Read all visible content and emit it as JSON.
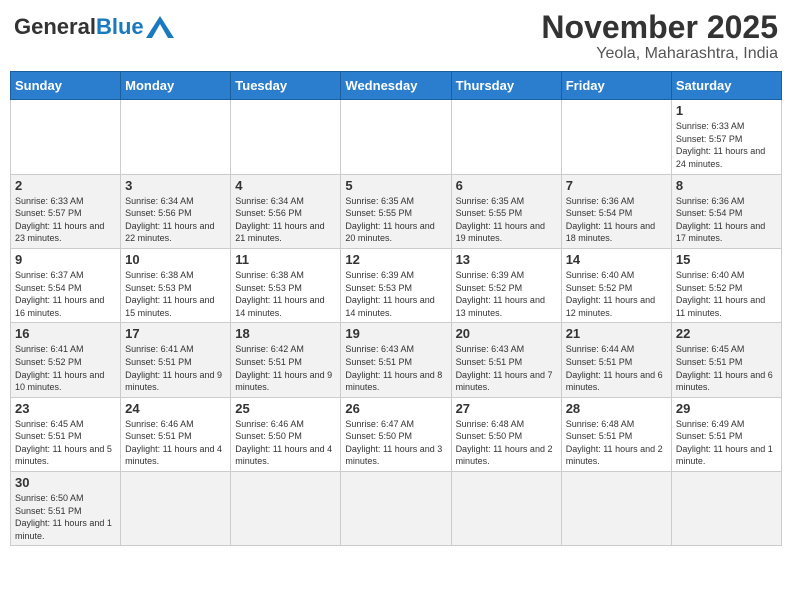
{
  "header": {
    "logo_general": "General",
    "logo_blue": "Blue",
    "month": "November 2025",
    "location": "Yeola, Maharashtra, India"
  },
  "days_of_week": [
    "Sunday",
    "Monday",
    "Tuesday",
    "Wednesday",
    "Thursday",
    "Friday",
    "Saturday"
  ],
  "weeks": [
    [
      {
        "day": "",
        "info": ""
      },
      {
        "day": "",
        "info": ""
      },
      {
        "day": "",
        "info": ""
      },
      {
        "day": "",
        "info": ""
      },
      {
        "day": "",
        "info": ""
      },
      {
        "day": "",
        "info": ""
      },
      {
        "day": "1",
        "info": "Sunrise: 6:33 AM\nSunset: 5:57 PM\nDaylight: 11 hours\nand 24 minutes."
      }
    ],
    [
      {
        "day": "2",
        "info": "Sunrise: 6:33 AM\nSunset: 5:57 PM\nDaylight: 11 hours\nand 23 minutes."
      },
      {
        "day": "3",
        "info": "Sunrise: 6:34 AM\nSunset: 5:56 PM\nDaylight: 11 hours\nand 22 minutes."
      },
      {
        "day": "4",
        "info": "Sunrise: 6:34 AM\nSunset: 5:56 PM\nDaylight: 11 hours\nand 21 minutes."
      },
      {
        "day": "5",
        "info": "Sunrise: 6:35 AM\nSunset: 5:55 PM\nDaylight: 11 hours\nand 20 minutes."
      },
      {
        "day": "6",
        "info": "Sunrise: 6:35 AM\nSunset: 5:55 PM\nDaylight: 11 hours\nand 19 minutes."
      },
      {
        "day": "7",
        "info": "Sunrise: 6:36 AM\nSunset: 5:54 PM\nDaylight: 11 hours\nand 18 minutes."
      },
      {
        "day": "8",
        "info": "Sunrise: 6:36 AM\nSunset: 5:54 PM\nDaylight: 11 hours\nand 17 minutes."
      }
    ],
    [
      {
        "day": "9",
        "info": "Sunrise: 6:37 AM\nSunset: 5:54 PM\nDaylight: 11 hours\nand 16 minutes."
      },
      {
        "day": "10",
        "info": "Sunrise: 6:38 AM\nSunset: 5:53 PM\nDaylight: 11 hours\nand 15 minutes."
      },
      {
        "day": "11",
        "info": "Sunrise: 6:38 AM\nSunset: 5:53 PM\nDaylight: 11 hours\nand 14 minutes."
      },
      {
        "day": "12",
        "info": "Sunrise: 6:39 AM\nSunset: 5:53 PM\nDaylight: 11 hours\nand 14 minutes."
      },
      {
        "day": "13",
        "info": "Sunrise: 6:39 AM\nSunset: 5:52 PM\nDaylight: 11 hours\nand 13 minutes."
      },
      {
        "day": "14",
        "info": "Sunrise: 6:40 AM\nSunset: 5:52 PM\nDaylight: 11 hours\nand 12 minutes."
      },
      {
        "day": "15",
        "info": "Sunrise: 6:40 AM\nSunset: 5:52 PM\nDaylight: 11 hours\nand 11 minutes."
      }
    ],
    [
      {
        "day": "16",
        "info": "Sunrise: 6:41 AM\nSunset: 5:52 PM\nDaylight: 11 hours\nand 10 minutes."
      },
      {
        "day": "17",
        "info": "Sunrise: 6:41 AM\nSunset: 5:51 PM\nDaylight: 11 hours\nand 9 minutes."
      },
      {
        "day": "18",
        "info": "Sunrise: 6:42 AM\nSunset: 5:51 PM\nDaylight: 11 hours\nand 9 minutes."
      },
      {
        "day": "19",
        "info": "Sunrise: 6:43 AM\nSunset: 5:51 PM\nDaylight: 11 hours\nand 8 minutes."
      },
      {
        "day": "20",
        "info": "Sunrise: 6:43 AM\nSunset: 5:51 PM\nDaylight: 11 hours\nand 7 minutes."
      },
      {
        "day": "21",
        "info": "Sunrise: 6:44 AM\nSunset: 5:51 PM\nDaylight: 11 hours\nand 6 minutes."
      },
      {
        "day": "22",
        "info": "Sunrise: 6:45 AM\nSunset: 5:51 PM\nDaylight: 11 hours\nand 6 minutes."
      }
    ],
    [
      {
        "day": "23",
        "info": "Sunrise: 6:45 AM\nSunset: 5:51 PM\nDaylight: 11 hours\nand 5 minutes."
      },
      {
        "day": "24",
        "info": "Sunrise: 6:46 AM\nSunset: 5:51 PM\nDaylight: 11 hours\nand 4 minutes."
      },
      {
        "day": "25",
        "info": "Sunrise: 6:46 AM\nSunset: 5:50 PM\nDaylight: 11 hours\nand 4 minutes."
      },
      {
        "day": "26",
        "info": "Sunrise: 6:47 AM\nSunset: 5:50 PM\nDaylight: 11 hours\nand 3 minutes."
      },
      {
        "day": "27",
        "info": "Sunrise: 6:48 AM\nSunset: 5:50 PM\nDaylight: 11 hours\nand 2 minutes."
      },
      {
        "day": "28",
        "info": "Sunrise: 6:48 AM\nSunset: 5:51 PM\nDaylight: 11 hours\nand 2 minutes."
      },
      {
        "day": "29",
        "info": "Sunrise: 6:49 AM\nSunset: 5:51 PM\nDaylight: 11 hours\nand 1 minute."
      }
    ],
    [
      {
        "day": "30",
        "info": "Sunrise: 6:50 AM\nSunset: 5:51 PM\nDaylight: 11 hours\nand 1 minute."
      },
      {
        "day": "",
        "info": ""
      },
      {
        "day": "",
        "info": ""
      },
      {
        "day": "",
        "info": ""
      },
      {
        "day": "",
        "info": ""
      },
      {
        "day": "",
        "info": ""
      },
      {
        "day": "",
        "info": ""
      }
    ]
  ]
}
